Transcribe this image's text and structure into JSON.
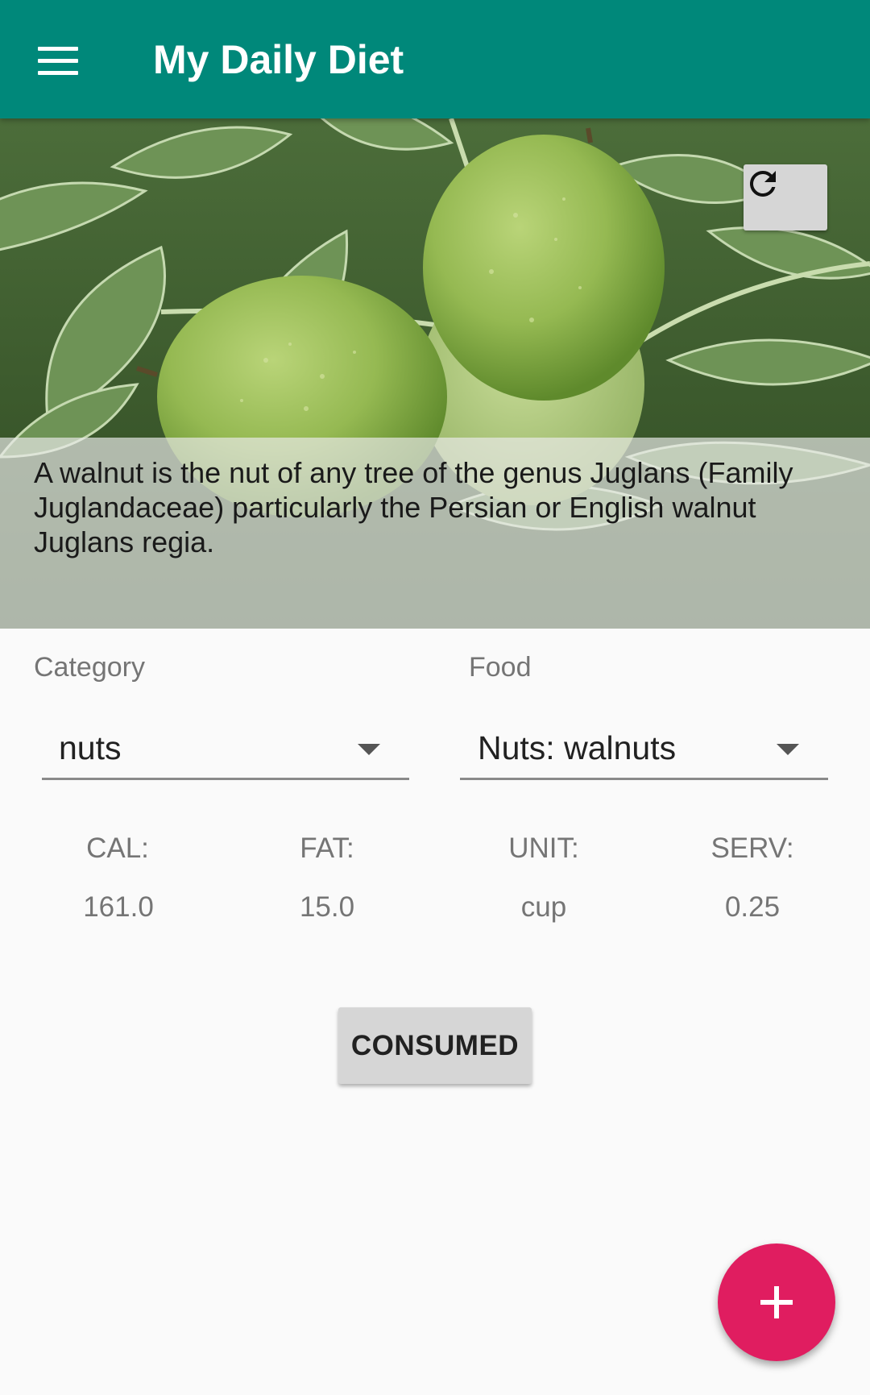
{
  "app_bar": {
    "title": "My Daily Diet",
    "menu_icon": "menu-icon",
    "color": "#00887a"
  },
  "hero": {
    "image": "walnut-tree-photo",
    "refresh_icon": "refresh-icon",
    "description": "A walnut is the nut of any tree of the genus Juglans (Family\nJuglandaceae)  particularly the Persian or English walnut\nJuglans regia."
  },
  "category": {
    "label": "Category",
    "selected": "nuts"
  },
  "food": {
    "label": "Food",
    "selected": "Nuts: walnuts"
  },
  "stats": [
    {
      "label": "CAL:",
      "value": "161.0"
    },
    {
      "label": "FAT:",
      "value": "15.0"
    },
    {
      "label": "UNIT:",
      "value": "cup"
    },
    {
      "label": "SERV:",
      "value": "0.25"
    }
  ],
  "consumed_button": {
    "label": "CONSUMED"
  },
  "fab": {
    "icon": "plus-icon",
    "color": "#e01d60"
  }
}
